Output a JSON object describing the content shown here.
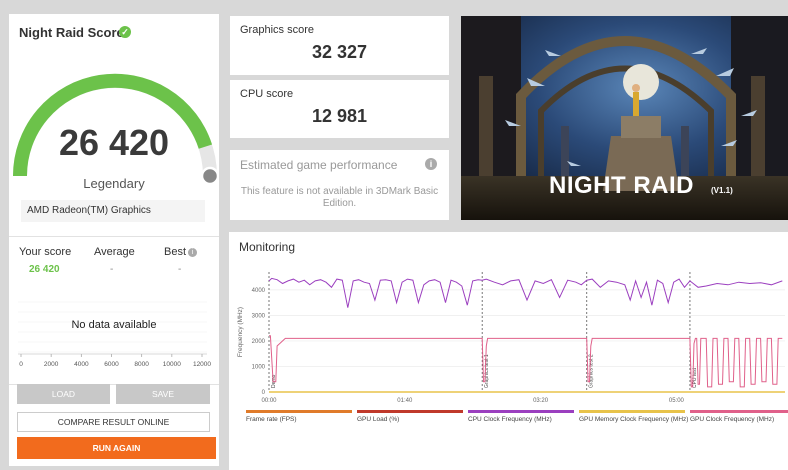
{
  "score_card": {
    "title": "Night Raid Score",
    "score": "26 420",
    "tier": "Legendary",
    "gpu": "AMD Radeon(TM) Graphics",
    "your_score_label": "Your score",
    "your_score_value": "26 420",
    "average_label": "Average",
    "average_value": "-",
    "best_label": "Best",
    "best_value": "-",
    "no_data": "No data available",
    "dist_ticks": [
      "0",
      "2000",
      "4000",
      "6000",
      "8000",
      "10000",
      "12000"
    ],
    "load_label": "LOAD",
    "save_label": "SAVE",
    "compare_label": "COMPARE RESULT ONLINE",
    "run_again_label": "RUN AGAIN",
    "gauge_fraction": 0.9
  },
  "graphics": {
    "label": "Graphics score",
    "value": "32 327"
  },
  "cpu": {
    "label": "CPU score",
    "value": "12 981"
  },
  "egp": {
    "label": "Estimated game performance",
    "text": "This feature is not available in 3DMark Basic Edition."
  },
  "banner": {
    "title": "NIGHT RAID",
    "version": "(V1.1)"
  },
  "monitoring": {
    "title": "Monitoring",
    "legend": [
      "Frame rate (FPS)",
      "GPU Load (%)",
      "CPU Clock Frequency (MHz)",
      "GPU Memory Clock Frequency (MHz)",
      "GPU Clock Frequency (MHz)"
    ]
  },
  "colors": {
    "accent_green": "#6cc24a",
    "orange": "#f26b1d",
    "cpu_clock": "#9b3fbf",
    "gpu_clock": "#e0608a",
    "gpu_load": "#c0392b",
    "frame_rate": "#e07b2a",
    "mem_clock": "#e8c34a"
  },
  "chart_data": {
    "type": "line",
    "xlabel": "",
    "ylabel": "Frequency (MHz)",
    "x_ticks": [
      "00:00",
      "01:40",
      "03:20",
      "05:00"
    ],
    "y_ticks": [
      0,
      1000,
      2000,
      3000,
      4000
    ],
    "ylim": [
      0,
      4700
    ],
    "xlim_seconds": [
      0,
      380
    ],
    "phase_markers": [
      {
        "t": 0,
        "label": "Demo"
      },
      {
        "t": 157,
        "label": "Graphics test 1"
      },
      {
        "t": 234,
        "label": "Graphics test 2"
      },
      {
        "t": 310,
        "label": "CPU test"
      }
    ],
    "series": [
      {
        "name": "CPU Clock Frequency (MHz)",
        "x": [
          0,
          2,
          6,
          10,
          14,
          18,
          22,
          26,
          30,
          34,
          38,
          42,
          46,
          50,
          54,
          58,
          62,
          66,
          70,
          74,
          78,
          82,
          86,
          90,
          94,
          98,
          102,
          106,
          110,
          114,
          118,
          122,
          126,
          130,
          134,
          138,
          142,
          146,
          150,
          154,
          157,
          160,
          166,
          172,
          178,
          184,
          190,
          196,
          202,
          208,
          214,
          220,
          226,
          230,
          234,
          238,
          244,
          250,
          256,
          262,
          266,
          270,
          274,
          278,
          282,
          286,
          290,
          294,
          298,
          302,
          306,
          310,
          316,
          322,
          330,
          338,
          346,
          354,
          362,
          370,
          378
        ],
        "y": [
          4350,
          4450,
          4400,
          4250,
          4350,
          4420,
          4300,
          4380,
          4200,
          4350,
          4400,
          4300,
          4100,
          4420,
          4380,
          3300,
          4350,
          4400,
          4300,
          4250,
          3600,
          4380,
          4400,
          4350,
          3500,
          4300,
          4420,
          4380,
          3500,
          4200,
          4350,
          4400,
          4300,
          3500,
          4380,
          4300,
          4150,
          3400,
          4350,
          4400,
          4380,
          4420,
          4300,
          4200,
          4350,
          4400,
          3600,
          4350,
          4250,
          4400,
          3700,
          4380,
          4300,
          4200,
          4380,
          4420,
          4100,
          4350,
          4300,
          4200,
          3600,
          4350,
          3700,
          4300,
          3400,
          4380,
          4250,
          3500,
          4300,
          4420,
          4100,
          4350,
          4100,
          4150,
          4250,
          4200,
          4300,
          4250,
          4280,
          4200,
          4350
        ]
      },
      {
        "name": "GPU Clock Frequency (MHz)",
        "x": [
          0,
          1,
          3,
          5,
          6,
          12,
          13,
          156,
          157,
          158,
          159,
          160,
          161,
          162,
          233,
          234,
          235,
          236,
          237,
          238,
          239,
          309,
          310,
          311,
          312,
          313,
          314,
          315,
          316,
          317,
          318,
          322,
          323,
          326,
          327,
          330,
          331,
          334,
          335,
          338,
          339,
          342,
          343,
          346,
          347,
          350,
          351,
          354,
          355,
          358,
          359,
          362,
          363,
          366,
          367,
          370,
          371,
          374,
          375,
          378
        ],
        "y": [
          2200,
          2200,
          400,
          400,
          1800,
          2100,
          2100,
          2100,
          2100,
          400,
          400,
          1800,
          2100,
          2100,
          2100,
          2100,
          400,
          400,
          1800,
          2100,
          2100,
          2100,
          2100,
          200,
          200,
          1900,
          2100,
          2100,
          300,
          300,
          2100,
          2100,
          200,
          200,
          2100,
          2100,
          300,
          300,
          2100,
          2100,
          400,
          400,
          2100,
          2100,
          200,
          200,
          2100,
          2100,
          300,
          300,
          2100,
          2100,
          400,
          400,
          2100,
          2100,
          300,
          300,
          2100,
          2100
        ]
      }
    ]
  }
}
